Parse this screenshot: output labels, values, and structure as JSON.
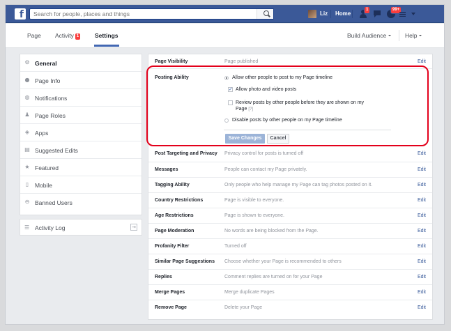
{
  "topbar": {
    "logo": "f",
    "search_placeholder": "Search for people, places and things",
    "user_name": "Liz",
    "home_label": "Home",
    "friend_badge": "1",
    "notif_badge": "99+"
  },
  "page_nav": {
    "tabs": [
      {
        "label": "Page"
      },
      {
        "label": "Activity",
        "badge": "1"
      },
      {
        "label": "Settings"
      }
    ],
    "build_audience": "Build Audience",
    "help": "Help"
  },
  "sidebar": {
    "items": [
      {
        "label": "General",
        "icon": "gear-icon"
      },
      {
        "label": "Page Info",
        "icon": "info-icon"
      },
      {
        "label": "Notifications",
        "icon": "globe-icon"
      },
      {
        "label": "Page Roles",
        "icon": "person-icon"
      },
      {
        "label": "Apps",
        "icon": "cube-icon"
      },
      {
        "label": "Suggested Edits",
        "icon": "edit-icon"
      },
      {
        "label": "Featured",
        "icon": "star-icon"
      },
      {
        "label": "Mobile",
        "icon": "mobile-icon"
      },
      {
        "label": "Banned Users",
        "icon": "ban-icon"
      }
    ],
    "activity_log": "Activity Log"
  },
  "settings": {
    "edit_label": "Edit",
    "page_visibility": {
      "label": "Page Visibility",
      "value": "Page published"
    },
    "posting_ability": {
      "label": "Posting Ability",
      "options": [
        "Allow other people to post to my Page timeline",
        "Allow photo and video posts",
        "Review posts by other people before they are shown on my",
        "Page",
        "[?]",
        "Disable posts by other people on my Page timeline"
      ],
      "save": "Save Changes",
      "cancel": "Cancel"
    },
    "rows": [
      {
        "label": "Post Targeting and Privacy",
        "value": "Privacy control for posts is turned off"
      },
      {
        "label": "Messages",
        "value": "People can contact my Page privately."
      },
      {
        "label": "Tagging Ability",
        "value": "Only people who help manage my Page can tag photos posted on it."
      },
      {
        "label": "Country Restrictions",
        "value": "Page is visible to everyone."
      },
      {
        "label": "Age Restrictions",
        "value": "Page is shown to everyone."
      },
      {
        "label": "Page Moderation",
        "value": "No words are being blocked from the Page."
      },
      {
        "label": "Profanity Filter",
        "value": "Turned off"
      },
      {
        "label": "Similar Page Suggestions",
        "value": "Choose whether your Page is recommended to others"
      },
      {
        "label": "Replies",
        "value": "Comment replies are turned on for your Page"
      },
      {
        "label": "Merge Pages",
        "value": "Merge duplicate Pages"
      },
      {
        "label": "Remove Page",
        "value": "Delete your Page"
      }
    ]
  },
  "colors": {
    "brand": "#3b5998",
    "highlight": "#e3001b",
    "link": "#365899"
  }
}
